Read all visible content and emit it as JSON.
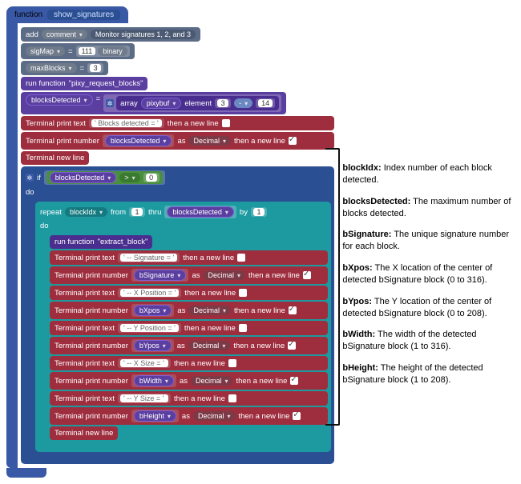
{
  "func": {
    "keyword": "function",
    "name": "show_signatures"
  },
  "comment": {
    "add": "add",
    "kw": "comment",
    "text": "Monitor signatures 1, 2, and 3"
  },
  "sigmap": {
    "name": "sigMap",
    "eq": "=",
    "val": "111",
    "suf": "binary"
  },
  "maxblocks": {
    "name": "maxBlocks",
    "eq": "=",
    "val": "3"
  },
  "runreq": {
    "pre": "run function",
    "name": "\"pixy_request_blocks\""
  },
  "bdet": {
    "name": "blocksDetected",
    "eq": "=",
    "array_kw": "array",
    "array_name": "pixybuf",
    "element": "element",
    "idx": "3",
    "op": "-",
    "right": "14"
  },
  "tp_text": "Terminal print text",
  "tp_num": "Terminal print number",
  "tp_nl": "Terminal new line",
  "then": "then a new line",
  "as": "as",
  "decimal": "Decimal",
  "txt": {
    "blocks": "' Blocks detected = '",
    "sig": "' -- Signature = '",
    "xpos": "' -- X Position = '",
    "ypos": "' -- Y Position = '",
    "xsize": "' -- X Size = '",
    "ysize": "' -- Y Size = '"
  },
  "if": {
    "kw": "if",
    "var": "blocksDetected",
    "op": ">",
    "zero": "0"
  },
  "do": "do",
  "repeat": {
    "kw": "repeat",
    "var": "blockIdx",
    "from": "from",
    "v1": "1",
    "thru": "thru",
    "to": "blocksDetected",
    "by": "by",
    "step": "1"
  },
  "runext": {
    "pre": "run function",
    "name": "\"extract_block\""
  },
  "vars": {
    "blocksDetected": "blocksDetected",
    "bSignature": "bSignature",
    "bXpos": "bXpos",
    "bYpos": "bYpos",
    "bWidth": "bWidth",
    "bHeight": "bHeight"
  },
  "legend": {
    "blockIdx": {
      "t": "blockIdx:",
      "d": " Index number of each block detected."
    },
    "blocksDetected": {
      "t": "blocksDetected:",
      "d": " The maximum number of blocks detected."
    },
    "bSignature": {
      "t": "bSignature:",
      "d": " The unique signature number for each block."
    },
    "bXpos": {
      "t": "bXpos:",
      "d": " The X location of the center of detected bSignature block (0 to 316)."
    },
    "bYpos": {
      "t": "bYpos:",
      "d": " The Y location of the center of detected bSignature block (0 to 208)."
    },
    "bWidth": {
      "t": "bWidth:",
      "d": " The width of the detected bSignature block (1 to 316)."
    },
    "bHeight": {
      "t": "bHeight:",
      "d": " The height of the detected bSignature block (1 to 208)."
    }
  }
}
